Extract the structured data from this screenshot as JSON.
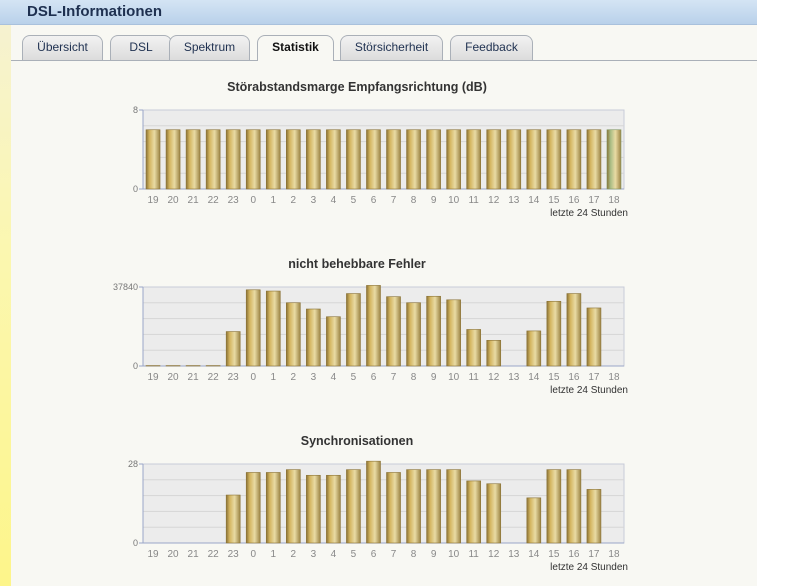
{
  "window": {
    "title": "DSL-Informationen"
  },
  "tabs": [
    {
      "label": "Übersicht"
    },
    {
      "label": "DSL"
    },
    {
      "label": "Spektrum"
    },
    {
      "label": "Statistik"
    },
    {
      "label": "Störsicherheit"
    },
    {
      "label": "Feedback"
    }
  ],
  "active_tab": "Statistik",
  "colors": {
    "bar": "#d4b560",
    "bar_current": "#a8bc84",
    "plot_bg": "#ececec",
    "axis": "#9aa6c8"
  },
  "chart_data": [
    {
      "type": "bar",
      "title": "Störabstandsmarge Empfangsrichtung (dB)",
      "categories": [
        "19",
        "20",
        "21",
        "22",
        "23",
        "0",
        "1",
        "2",
        "3",
        "4",
        "5",
        "6",
        "7",
        "8",
        "9",
        "10",
        "11",
        "12",
        "13",
        "14",
        "15",
        "16",
        "17",
        "18"
      ],
      "values": [
        6,
        6,
        6,
        6,
        6,
        6,
        6,
        6,
        6,
        6,
        6,
        6,
        6,
        6,
        6,
        6,
        6,
        6,
        6,
        6,
        6,
        6,
        6,
        6
      ],
      "highlight_index": 23,
      "ylim": [
        0,
        8
      ],
      "yticks": [
        "0",
        "8"
      ],
      "note": "letzte 24 Stunden"
    },
    {
      "type": "bar",
      "title": "nicht behebbare Fehler",
      "categories": [
        "19",
        "20",
        "21",
        "22",
        "23",
        "0",
        "1",
        "2",
        "3",
        "4",
        "5",
        "6",
        "7",
        "8",
        "9",
        "10",
        "11",
        "12",
        "13",
        "14",
        "15",
        "16",
        "17",
        "18"
      ],
      "values": [
        200,
        200,
        200,
        200,
        16500,
        36500,
        35900,
        30300,
        27300,
        23600,
        34700,
        38600,
        33200,
        30300,
        33400,
        31700,
        17500,
        12300,
        0,
        16800,
        31000,
        34700,
        27800,
        0
      ],
      "ylim": [
        0,
        37840
      ],
      "yticks": [
        "0",
        "37840"
      ],
      "note": "letzte 24 Stunden"
    },
    {
      "type": "bar",
      "title": "Synchronisationen",
      "categories": [
        "19",
        "20",
        "21",
        "22",
        "23",
        "0",
        "1",
        "2",
        "3",
        "4",
        "5",
        "6",
        "7",
        "8",
        "9",
        "10",
        "11",
        "12",
        "13",
        "14",
        "15",
        "16",
        "17",
        "18"
      ],
      "values": [
        0,
        0,
        0,
        0,
        17,
        25,
        25,
        26,
        24,
        24,
        26,
        29,
        25,
        26,
        26,
        26,
        22,
        21,
        0,
        16,
        26,
        26,
        19,
        0
      ],
      "ylim": [
        0,
        28
      ],
      "yticks": [
        "0",
        "28"
      ],
      "note": "letzte 24 Stunden"
    }
  ]
}
